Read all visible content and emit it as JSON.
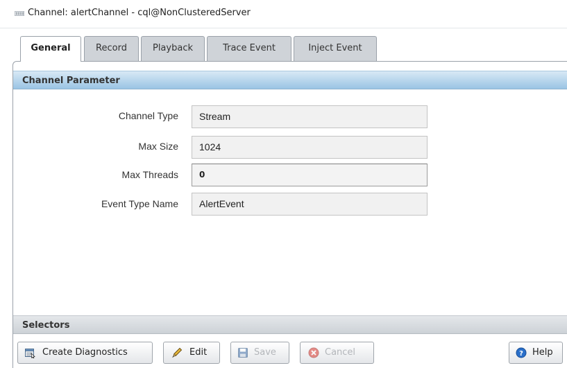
{
  "window": {
    "title": "Channel: alertChannel - cql@NonClusteredServer",
    "icon": "channel-icon"
  },
  "tabs": [
    {
      "label": "General",
      "active": true
    },
    {
      "label": "Record",
      "active": false
    },
    {
      "label": "Playback",
      "active": false
    },
    {
      "label": "Trace Event",
      "active": false
    },
    {
      "label": "Inject Event",
      "active": false
    }
  ],
  "channel_parameter": {
    "header": "Channel Parameter",
    "fields": [
      {
        "label": "Channel Type",
        "value": "Stream"
      },
      {
        "label": "Max Size",
        "value": "1024"
      },
      {
        "label": "Max Threads",
        "value": "0"
      },
      {
        "label": "Event Type Name",
        "value": "AlertEvent"
      }
    ]
  },
  "selectors": {
    "header": "Selectors"
  },
  "toolbar": {
    "create_diagnostics": {
      "label": "Create Diagnostics",
      "icon": "diagnostics-icon"
    },
    "edit": {
      "label": "Edit",
      "icon": "pencil-icon"
    },
    "save": {
      "label": "Save",
      "icon": "floppy-disk-icon",
      "enabled": false
    },
    "cancel": {
      "label": "Cancel",
      "icon": "cancel-x-icon",
      "enabled": false
    },
    "help": {
      "label": "Help",
      "icon": "help-icon"
    }
  },
  "colors": {
    "section_header_blue": "#9ac4e4",
    "section_header_gray": "#cdd2d7",
    "cancel_red": "#d9342b",
    "help_blue": "#2a6fc9"
  }
}
